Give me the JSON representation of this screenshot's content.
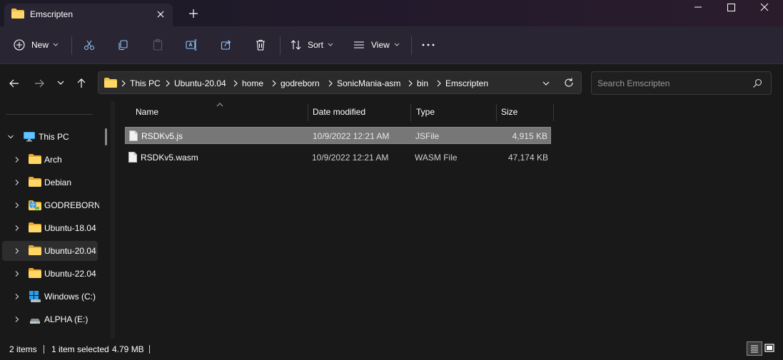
{
  "window": {
    "tab_title": "Emscripten",
    "icons": [
      "folder-icon",
      "close-icon",
      "plus-icon",
      "minimize-icon",
      "maximize-icon",
      "close-icon"
    ]
  },
  "toolbar": {
    "new_label": "New",
    "sort_label": "Sort",
    "view_label": "View"
  },
  "address": {
    "breadcrumbs": [
      "This PC",
      "Ubuntu-20.04",
      "home",
      "godreborn",
      "SonicMania-asm",
      "bin",
      "Emscripten"
    ]
  },
  "search": {
    "placeholder": "Search Emscripten"
  },
  "sidebar": {
    "items": [
      {
        "label": "This PC",
        "icon": "monitor-icon"
      },
      {
        "label": "Arch",
        "icon": "folder-icon"
      },
      {
        "label": "Debian",
        "icon": "folder-icon"
      },
      {
        "label": "GODREBORN-S",
        "icon": "network-folder-icon"
      },
      {
        "label": "Ubuntu-18.04",
        "icon": "folder-icon"
      },
      {
        "label": "Ubuntu-20.04",
        "icon": "folder-icon"
      },
      {
        "label": "Ubuntu-22.04",
        "icon": "folder-icon"
      },
      {
        "label": "Windows (C:)",
        "icon": "windows-drive-icon"
      },
      {
        "label": "ALPHA (E:)",
        "icon": "drive-icon"
      }
    ]
  },
  "files": {
    "columns": [
      "Name",
      "Date modified",
      "Type",
      "Size"
    ],
    "rows": [
      {
        "name": "RSDKv5.js",
        "date": "10/9/2022 12:21 AM",
        "type": "JSFile",
        "size": "4,915 KB"
      },
      {
        "name": "RSDKv5.wasm",
        "date": "10/9/2022 12:21 AM",
        "type": "WASM File",
        "size": "47,174 KB"
      }
    ]
  },
  "status": {
    "item_count": "2 items",
    "selected": "1 item selected",
    "selected_size": "4.79 MB"
  },
  "colors": {
    "accent_folder": "#f4c04a",
    "selection": "#777777",
    "background": "#191919",
    "toolbar": "#2a2533"
  }
}
